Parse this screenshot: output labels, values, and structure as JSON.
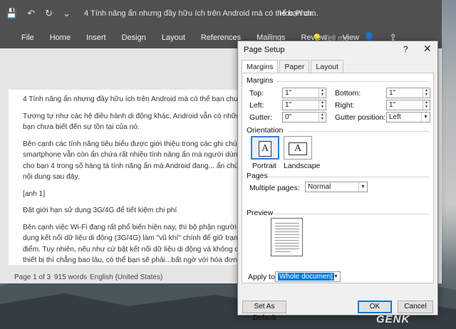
{
  "word": {
    "doc_title": "4 Tính năng ẩn nhưng đầy hữu ích trên Android mà có thể bạn ch...",
    "user": "Hoc Pham",
    "tabs": [
      "File",
      "Home",
      "Insert",
      "Design",
      "Layout",
      "References",
      "Mailings",
      "Review",
      "View"
    ],
    "tell_me": "Tell me",
    "paragraphs": [
      "4 Tính năng ẩn nhưng đầy hữu ích trên Android mà có thể bạn chưa biết",
      "Tương tự như các hệ điều hành di động khác, Android vẫn có những tín",
      "bạn chưa biết đến sự tồn tại của nó.",
      "Bên cạnh các tính năng tiêu biểu được giới thiệu trong các ghi chú phát",
      "smartphone vẫn còn ẩn chứa rất nhiều tính năng ẩn mà người dùng khô",
      "cho bạn 4 trong số hàng tá tính năng ẩn mà Android đang... ẩn chứa. Nế",
      "nội dung sau đây.",
      "[anh 1]",
      "Đặt giới hạn sử dụng 3G/4G để tiết kiệm chi phí",
      "Bên cạnh việc Wi-Fi đang rất phổ biến hiện nay, thì bộ phận người d",
      "dụng kết nối dữ liệu di động (3G/4G) làm \"vũ khí\" chính để giữ trạng thá",
      "điểm. Tuy nhiên, nếu như cứ bật kết nối dữ liệu di động và không quản",
      "thiết bị thì chẳng bao lâu, có thể bạn sẽ phải...bất ngờ với hóa đơn tiền cư"
    ],
    "status": {
      "page": "Page 1 of 3",
      "words": "915 words",
      "language": "English (United States)"
    }
  },
  "dialog": {
    "title": "Page Setup",
    "help": "?",
    "close": "✕",
    "tabs": [
      "Margins",
      "Paper",
      "Layout"
    ],
    "margins_label": "Margins",
    "top_label": "Top:",
    "top_value": "1\"",
    "bottom_label": "Bottom:",
    "bottom_value": "1\"",
    "left_label": "Left:",
    "left_value": "1\"",
    "right_label": "Right:",
    "right_value": "1\"",
    "gutter_label": "Gutter:",
    "gutter_value": "0\"",
    "gutter_pos_label": "Gutter position:",
    "gutter_pos_value": "Left",
    "orientation_label": "Orientation",
    "portrait": "Portrait",
    "landscape": "Landscape",
    "orient_glyph": "A",
    "pages_label": "Pages",
    "multiple_pages_label": "Multiple pages:",
    "multiple_pages_value": "Normal",
    "preview_label": "Preview",
    "apply_to_label": "Apply to:",
    "apply_to_value": "Whole document",
    "set_default": "Set As Default",
    "ok": "OK",
    "cancel": "Cancel"
  },
  "watermark": "GENK",
  "colors": {
    "accent": "#0078d7",
    "titlebar": "#505050"
  }
}
